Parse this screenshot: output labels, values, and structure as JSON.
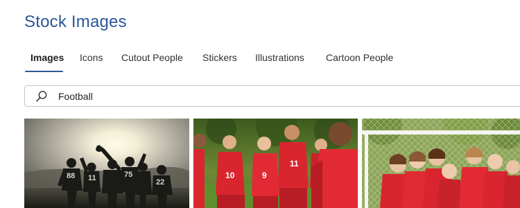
{
  "header": {
    "title": "Stock Images"
  },
  "tabs": [
    {
      "label": "Images",
      "active": true
    },
    {
      "label": "Icons"
    },
    {
      "label": "Cutout People"
    },
    {
      "label": "Stickers"
    },
    {
      "label": "Illustrations"
    },
    {
      "label": "Cartoon People"
    }
  ],
  "search": {
    "value": "Football",
    "icon": "search-icon"
  },
  "results": {
    "images": [
      {
        "kind": "photo",
        "jersey_numbers": [
          "88",
          "11",
          "75",
          "22"
        ]
      },
      {
        "kind": "photo",
        "jersey_numbers": [
          "10",
          "9",
          "11"
        ]
      },
      {
        "kind": "photo"
      }
    ]
  },
  "colors": {
    "accent": "#2b5797",
    "jersey_red": "#d9252e"
  }
}
